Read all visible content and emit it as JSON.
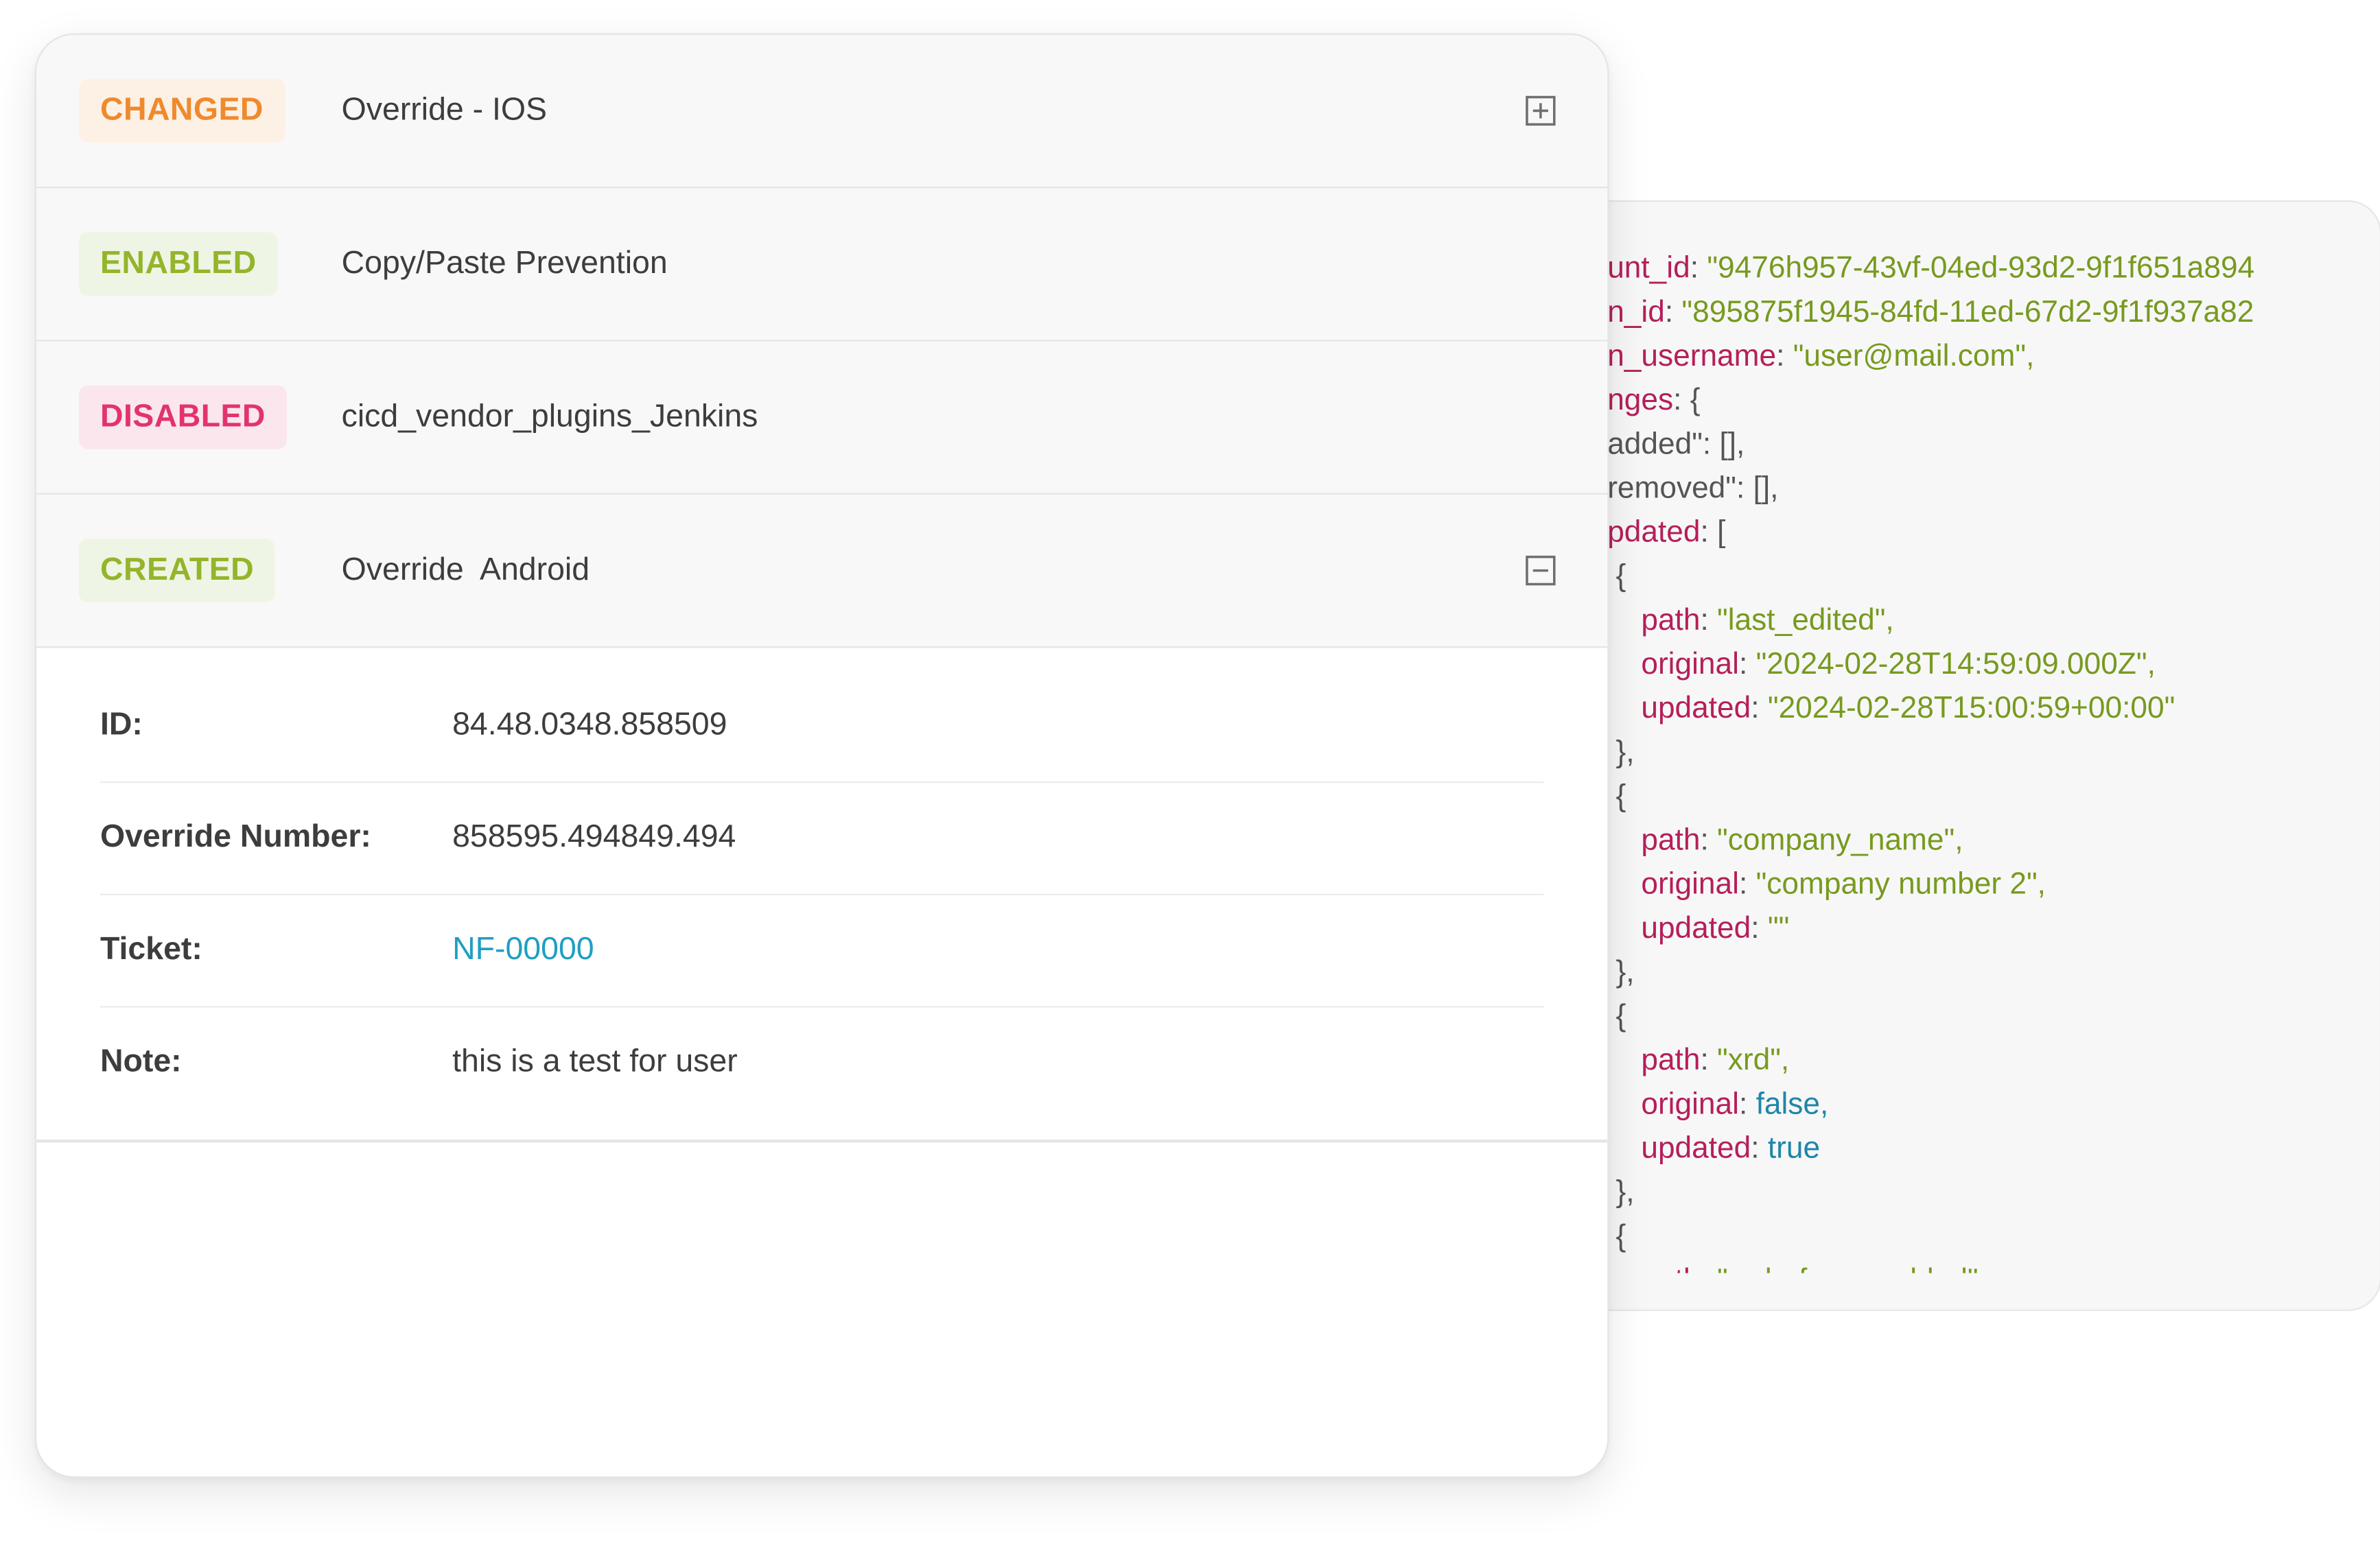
{
  "accordion": {
    "rows": [
      {
        "badge": "CHANGED",
        "title": "Override - IOS",
        "toggle": "plus-square-icon"
      },
      {
        "badge": "ENABLED",
        "title": "Copy/Paste Prevention"
      },
      {
        "badge": "DISABLED",
        "title": "cicd_vendor_plugins_Jenkins"
      },
      {
        "badge": "CREATED",
        "title": "Override  Android",
        "toggle": "minus-square-icon"
      }
    ],
    "details": [
      {
        "label": "ID:",
        "value": "84.48.0348.858509"
      },
      {
        "label": "Override Number:",
        "value": "858595.494849.494"
      },
      {
        "label": "Ticket:",
        "value": "NF-00000"
      },
      {
        "label": "Note:",
        "value": "this is a test for user"
      }
    ]
  },
  "code": {
    "lines": [
      [
        {
          "k": "key",
          "t": "unt_id"
        },
        {
          "k": "punc",
          "t": ": "
        },
        {
          "k": "str",
          "t": "\"9476h957-43vf-04ed-93d2-9f1f651a894"
        }
      ],
      [
        {
          "k": "key",
          "t": "n_id"
        },
        {
          "k": "punc",
          "t": ": "
        },
        {
          "k": "str",
          "t": "\"895875f1945-84fd-11ed-67d2-9f1f937a82"
        }
      ],
      [
        {
          "k": "key",
          "t": "n_username"
        },
        {
          "k": "punc",
          "t": ": "
        },
        {
          "k": "str",
          "t": "\"user@mail.com\","
        }
      ],
      [
        {
          "k": "key",
          "t": "nges"
        },
        {
          "k": "punc",
          "t": ": {"
        }
      ],
      [
        {
          "k": "punc",
          "t": "added\": [],"
        }
      ],
      [
        {
          "k": "punc",
          "t": "removed\": [],"
        }
      ],
      [
        {
          "k": "key",
          "t": "pdated"
        },
        {
          "k": "punc",
          "t": ": ["
        }
      ],
      [
        {
          "k": "punc",
          "t": " {"
        }
      ],
      [
        {
          "k": "key",
          "t": "    path"
        },
        {
          "k": "punc",
          "t": ": "
        },
        {
          "k": "str",
          "t": "\"last_edited\","
        }
      ],
      [
        {
          "k": "key",
          "t": "    original"
        },
        {
          "k": "punc",
          "t": ": "
        },
        {
          "k": "str",
          "t": "\"2024-02-28T14:59:09.000Z\","
        }
      ],
      [
        {
          "k": "key",
          "t": "    updated"
        },
        {
          "k": "punc",
          "t": ": "
        },
        {
          "k": "str",
          "t": "\"2024-02-28T15:00:59+00:00\""
        }
      ],
      [
        {
          "k": "punc",
          "t": " },"
        }
      ],
      [
        {
          "k": "punc",
          "t": " {"
        }
      ],
      [
        {
          "k": "key",
          "t": "    path"
        },
        {
          "k": "punc",
          "t": ": "
        },
        {
          "k": "str",
          "t": "\"company_name\","
        }
      ],
      [
        {
          "k": "key",
          "t": "    original"
        },
        {
          "k": "punc",
          "t": ": "
        },
        {
          "k": "str",
          "t": "\"company number 2\","
        }
      ],
      [
        {
          "k": "key",
          "t": "    updated"
        },
        {
          "k": "punc",
          "t": ": "
        },
        {
          "k": "str",
          "t": "\"\""
        }
      ],
      [
        {
          "k": "punc",
          "t": " },"
        }
      ],
      [
        {
          "k": "punc",
          "t": " {"
        }
      ],
      [
        {
          "k": "key",
          "t": "    path"
        },
        {
          "k": "punc",
          "t": ": "
        },
        {
          "k": "str",
          "t": "\"xrd\","
        }
      ],
      [
        {
          "k": "key",
          "t": "    original"
        },
        {
          "k": "punc",
          "t": ": "
        },
        {
          "k": "bool",
          "t": "false,"
        }
      ],
      [
        {
          "k": "key",
          "t": "    updated"
        },
        {
          "k": "punc",
          "t": ": "
        },
        {
          "k": "bool",
          "t": "true"
        }
      ],
      [
        {
          "k": "punc",
          "t": " },"
        }
      ],
      [
        {
          "k": "punc",
          "t": " {"
        }
      ],
      [
        {
          "k": "key",
          "t": "    path"
        },
        {
          "k": "punc",
          "t": ": "
        },
        {
          "k": "str",
          "t": "\"radarfmr_enabled\","
        }
      ]
    ]
  }
}
